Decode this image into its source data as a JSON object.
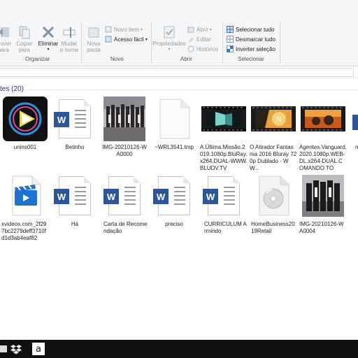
{
  "ribbon": {
    "move_label": [
      "Mover",
      "para"
    ],
    "copy_label": [
      "Copiar",
      "para"
    ],
    "delete_label": "Eliminar",
    "rename_label": [
      "Mudar",
      "o nome"
    ],
    "new_folder_label": [
      "Nova",
      "pasta"
    ],
    "new_item_label": "Novo item",
    "easy_access_label": "Acesso fácil",
    "properties_label": "Propriedades",
    "open_label": "Abrir",
    "edit_label": "Editar",
    "history_label": "Histórico",
    "select_all_label": "Selecionar tudo",
    "select_none_label": "Desmarcar tudo",
    "invert_selection_label": "Inverter seleção",
    "groups": {
      "organize": "Organizar",
      "new": "Novo",
      "open": "Abrir",
      "select": "Selecionar"
    }
  },
  "section": {
    "title": "tes (20)"
  },
  "files": [
    {
      "name": "unins001",
      "type": "app"
    },
    {
      "name": "Betinho",
      "type": "word"
    },
    {
      "name": "IMG-20210126-WA0000",
      "type": "photo"
    },
    {
      "name": "~WRL3541.tmp",
      "type": "blank"
    },
    {
      "name": "A.Última.Missão.2019.1080p.BluRay.x264.DUAL-WWW.BLUDV.TV",
      "type": "video"
    },
    {
      "name": "O Atirador Fantasma 2016 Bluray 720p Dublado - WW...",
      "type": "video"
    },
    {
      "name": "Agentes.Vanguard.2020.1080p.WEB-DL.x264-DUAL.COMANDO.TO",
      "type": "video"
    },
    {
      "name": "xvideos.com_2f297bc2279deff3710fd1d3ab4eaf82",
      "type": "clip"
    },
    {
      "name": "Há",
      "type": "word"
    },
    {
      "name": "Carta de Recomendação",
      "type": "word"
    },
    {
      "name": "preciso",
      "type": "word"
    },
    {
      "name": "CURRICULUM Armindo",
      "type": "word"
    },
    {
      "name": "HomeBusiness2019Retail",
      "type": "disc"
    },
    {
      "name": "IMG-20210126-WA0004",
      "type": "photo"
    }
  ],
  "taskbar": {
    "items": [
      "dropbox-icon",
      "amazon-icon"
    ]
  },
  "colors": {
    "word_blue": "#2b579a",
    "accent": "#1e3287",
    "taskbar": "#101010"
  }
}
